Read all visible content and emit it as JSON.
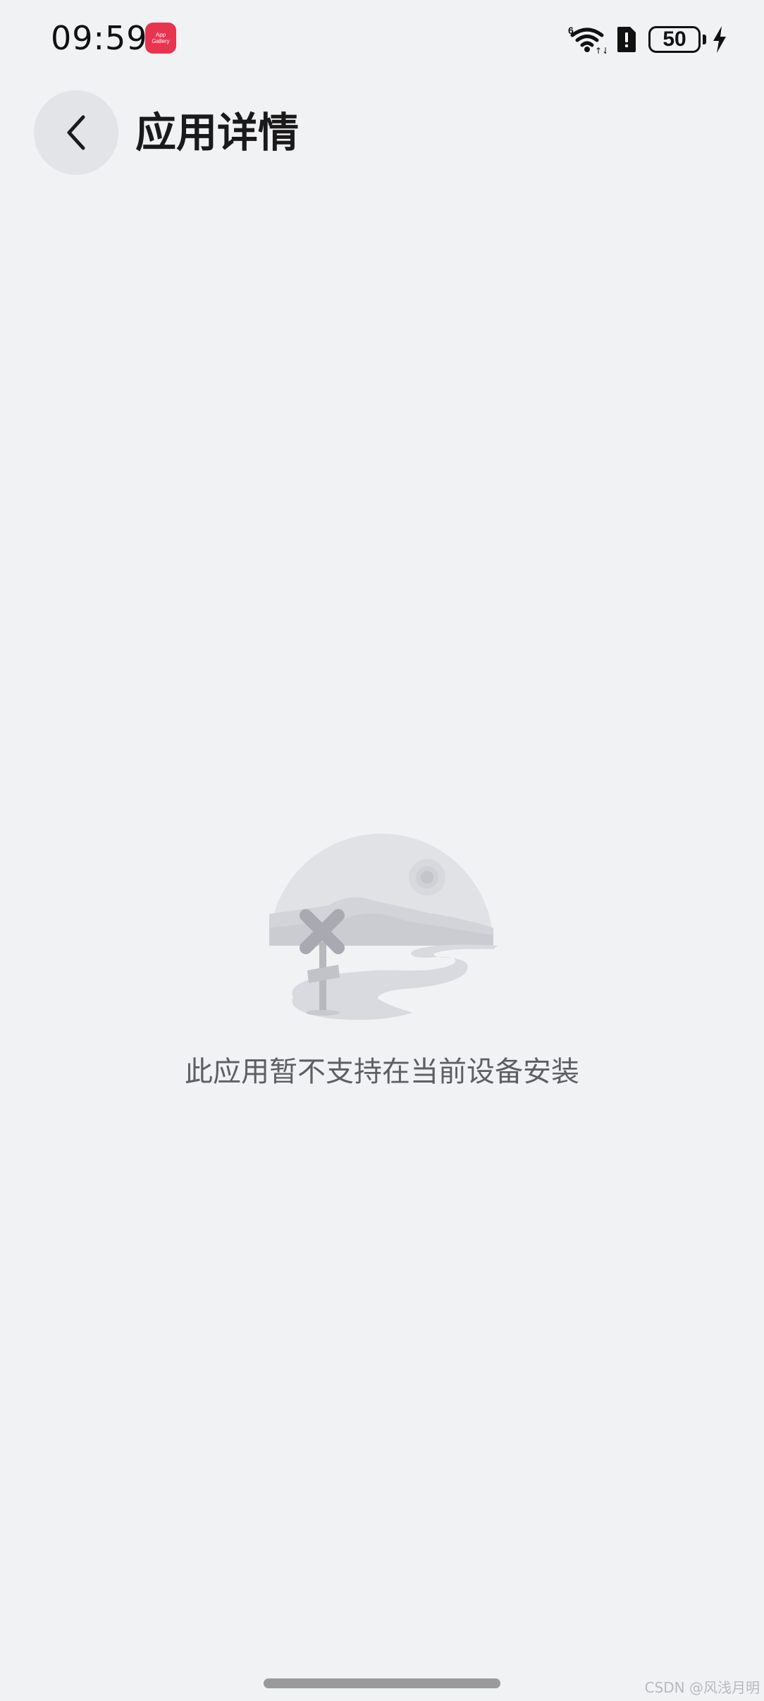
{
  "status_bar": {
    "time": "09:59",
    "app_icon": {
      "name": "app-gallery-icon",
      "line1": "App",
      "line2": "Gallery",
      "color": "#e8344f"
    },
    "network_badge": "6",
    "wifi_arrows": "↑↓",
    "battery_level": "50",
    "icons": [
      "wifi-icon",
      "sim-alert-icon",
      "battery-icon",
      "charging-icon"
    ]
  },
  "header": {
    "back_icon": "chevron-left-icon",
    "title": "应用详情"
  },
  "empty_state": {
    "illustration": "unsupported-landscape-illustration",
    "message": "此应用暂不支持在当前设备安装"
  },
  "watermark": "CSDN @风浅月明",
  "colors": {
    "background": "#f1f2f4",
    "back_button_bg": "#e3e4e7",
    "message_text": "#5e5f63"
  }
}
